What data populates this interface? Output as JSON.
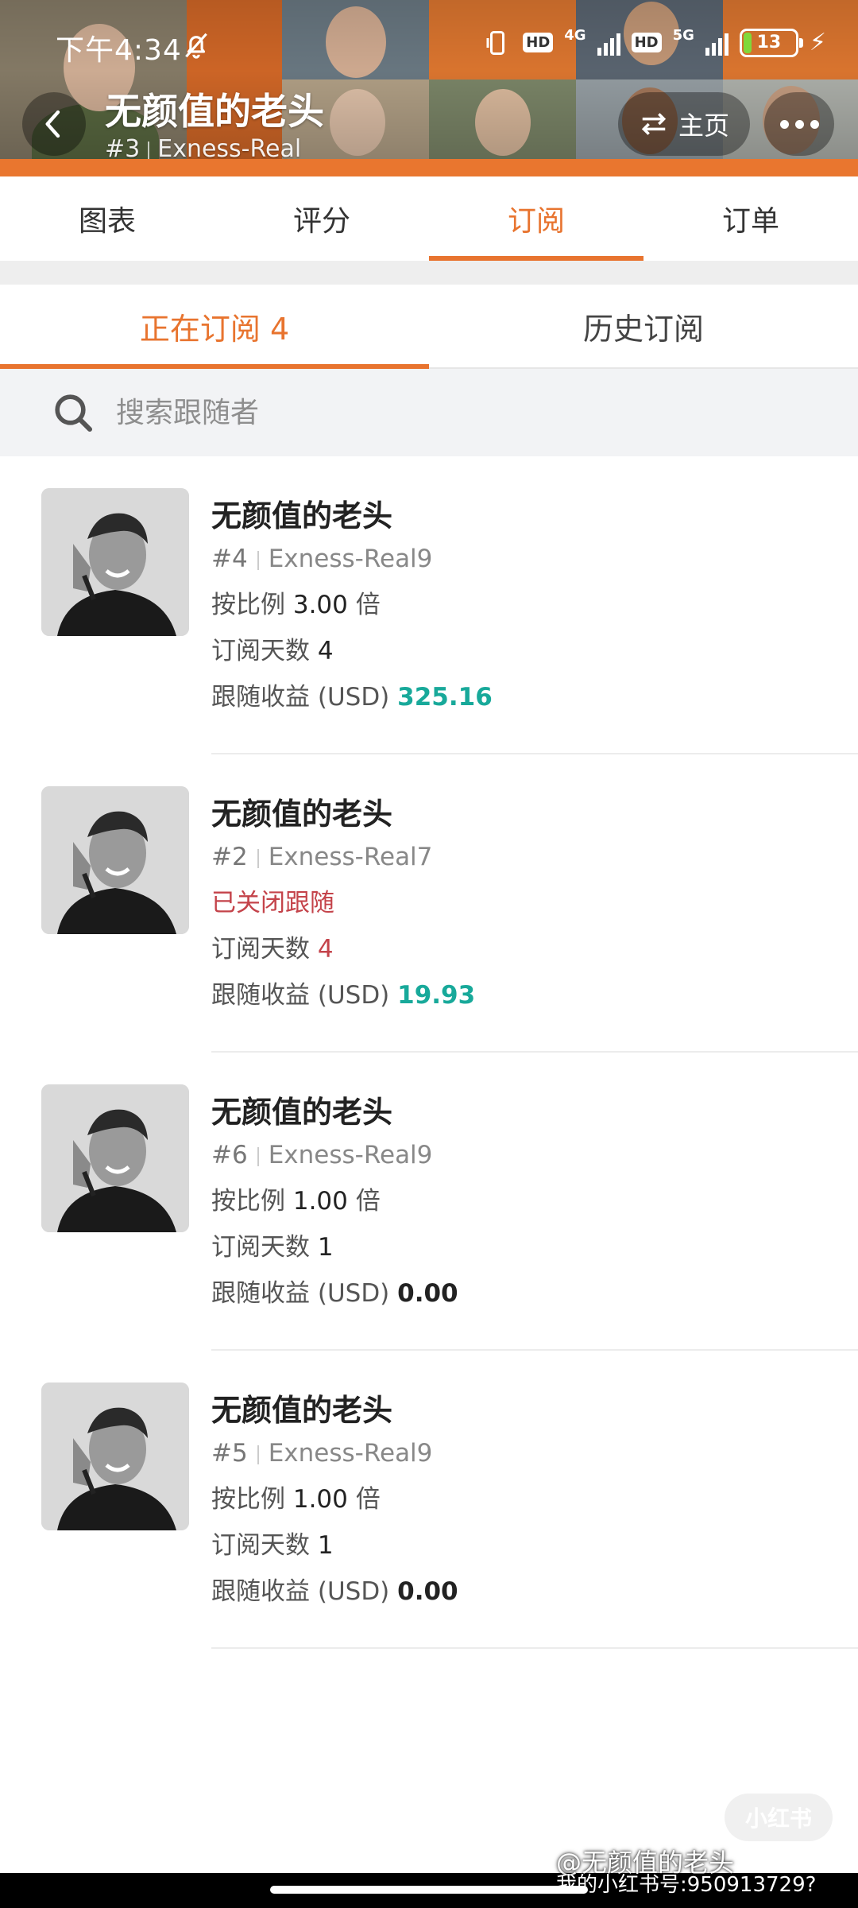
{
  "status_bar": {
    "time": "下午4:34",
    "net1": "4G",
    "net2": "5G",
    "hd": "HD",
    "battery": "13"
  },
  "header": {
    "title": "无颜值的老头",
    "rank": "#3",
    "account": "Exness-Real",
    "home_label": "主页"
  },
  "tabs": [
    {
      "label": "图表"
    },
    {
      "label": "评分"
    },
    {
      "label": "订阅"
    },
    {
      "label": "订单"
    }
  ],
  "sub_tabs": [
    {
      "label": "正在订阅 4"
    },
    {
      "label": "历史订阅"
    }
  ],
  "search": {
    "placeholder": "搜索跟随者"
  },
  "labels": {
    "ratio": "按比例",
    "times": "倍",
    "days": "订阅天数",
    "profit": "跟随收益 (USD)"
  },
  "items": [
    {
      "name": "无颜值的老头",
      "rank": "#4",
      "account": "Exness-Real9",
      "ratio": "3.00",
      "days": "4",
      "profit": "325.16"
    },
    {
      "name": "无颜值的老头",
      "rank": "#2",
      "account": "Exness-Real7",
      "status": "已关闭跟随",
      "days": "4",
      "profit": "19.93"
    },
    {
      "name": "无颜值的老头",
      "rank": "#6",
      "account": "Exness-Real9",
      "ratio": "1.00",
      "days": "1",
      "profit": "0.00"
    },
    {
      "name": "无颜值的老头",
      "rank": "#5",
      "account": "Exness-Real9",
      "ratio": "1.00",
      "days": "1",
      "profit": "0.00"
    }
  ],
  "watermark": {
    "logo": "小红书",
    "handle": "@无颜值的老头",
    "id": "我的小红书号:950913729?"
  },
  "colors": {
    "accent": "#e8742f",
    "profit_positive": "#18a99a",
    "closed": "#c4434a"
  }
}
